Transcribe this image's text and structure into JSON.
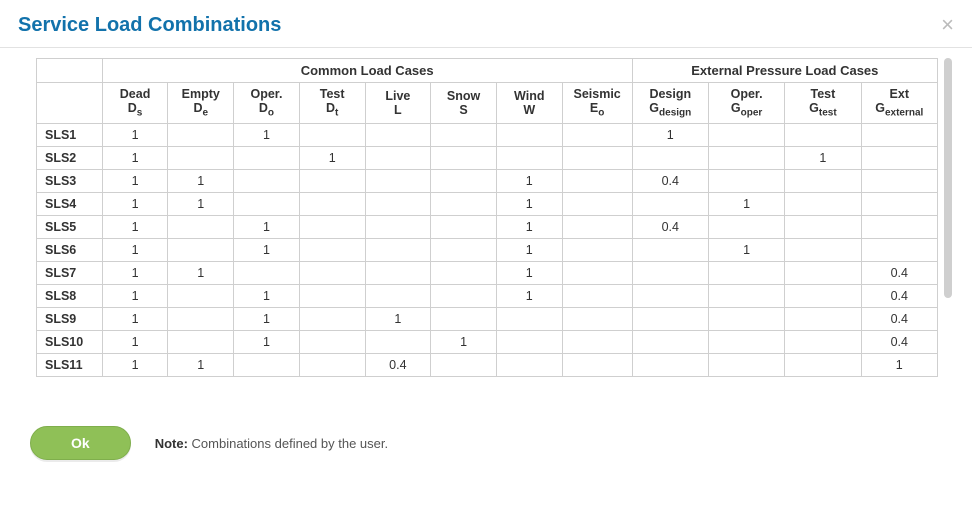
{
  "modal": {
    "title": "Service Load Combinations",
    "close_label": "×"
  },
  "groupHeaders": {
    "common": "Common Load Cases",
    "external": "External Pressure Load Cases"
  },
  "columns": [
    {
      "top": "Dead",
      "sub": "s"
    },
    {
      "top": "Empty",
      "sub": "e"
    },
    {
      "top": "Oper.",
      "sub": "o"
    },
    {
      "top": "Test",
      "sub": "t"
    },
    {
      "top": "Live",
      "subL": "L"
    },
    {
      "top": "Snow",
      "subL": "S"
    },
    {
      "top": "Wind",
      "subL": "W"
    },
    {
      "top": "Seismic",
      "subE": "o"
    },
    {
      "top": "Design",
      "subG": "design"
    },
    {
      "top": "Oper.",
      "subG": "oper"
    },
    {
      "top": "Test",
      "subG": "test"
    },
    {
      "top": "Ext",
      "subG": "external"
    }
  ],
  "rows": [
    {
      "name": "SLS1",
      "v": [
        "1",
        "",
        "1",
        "",
        "",
        "",
        "",
        "",
        "1",
        "",
        "",
        ""
      ]
    },
    {
      "name": "SLS2",
      "v": [
        "1",
        "",
        "",
        "1",
        "",
        "",
        "",
        "",
        "",
        "",
        "1",
        ""
      ]
    },
    {
      "name": "SLS3",
      "v": [
        "1",
        "1",
        "",
        "",
        "",
        "",
        "1",
        "",
        "0.4",
        "",
        "",
        ""
      ]
    },
    {
      "name": "SLS4",
      "v": [
        "1",
        "1",
        "",
        "",
        "",
        "",
        "1",
        "",
        "",
        "1",
        "",
        ""
      ]
    },
    {
      "name": "SLS5",
      "v": [
        "1",
        "",
        "1",
        "",
        "",
        "",
        "1",
        "",
        "0.4",
        "",
        "",
        ""
      ]
    },
    {
      "name": "SLS6",
      "v": [
        "1",
        "",
        "1",
        "",
        "",
        "",
        "1",
        "",
        "",
        "1",
        "",
        ""
      ]
    },
    {
      "name": "SLS7",
      "v": [
        "1",
        "1",
        "",
        "",
        "",
        "",
        "1",
        "",
        "",
        "",
        "",
        "0.4"
      ]
    },
    {
      "name": "SLS8",
      "v": [
        "1",
        "",
        "1",
        "",
        "",
        "",
        "1",
        "",
        "",
        "",
        "",
        "0.4"
      ]
    },
    {
      "name": "SLS9",
      "v": [
        "1",
        "",
        "1",
        "",
        "1",
        "",
        "",
        "",
        "",
        "",
        "",
        "0.4"
      ]
    },
    {
      "name": "SLS10",
      "v": [
        "1",
        "",
        "1",
        "",
        "",
        "1",
        "",
        "",
        "",
        "",
        "",
        "0.4"
      ]
    },
    {
      "name": "SLS11",
      "v": [
        "1",
        "1",
        "",
        "",
        "0.4",
        "",
        "",
        "",
        "",
        "",
        "",
        "1"
      ]
    }
  ],
  "footer": {
    "ok": "Ok",
    "note_label": "Note:",
    "note_text": "Combinations defined by the user."
  }
}
